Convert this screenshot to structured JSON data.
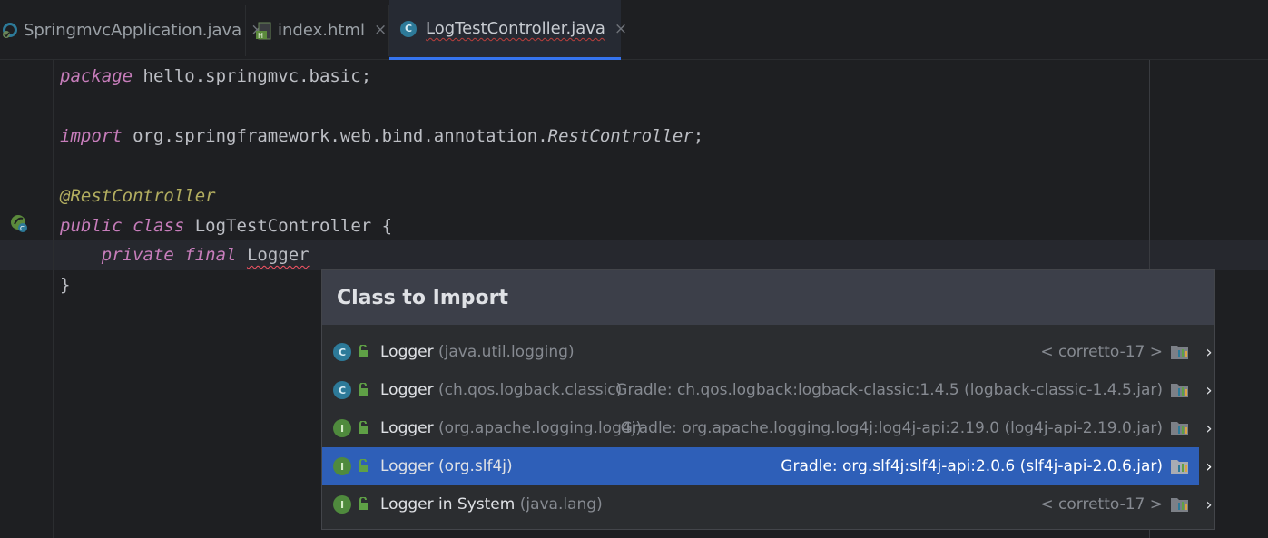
{
  "tabs": [
    {
      "label": "SpringmvcApplication.java",
      "icon": "spring-class-icon",
      "close": "×"
    },
    {
      "label": "index.html",
      "icon": "html-file-icon",
      "close": "×"
    },
    {
      "label": "LogTestController.java",
      "icon": "class-icon",
      "close": "×",
      "active": true
    }
  ],
  "code": {
    "line1": {
      "kw": "package",
      "rest": " hello.springmvc.basic;"
    },
    "line3": {
      "kw": "import",
      "pkg": " org.springframework.web.bind.annotation.",
      "cls": "RestController",
      "end": ";"
    },
    "line5": {
      "ann": "@RestController"
    },
    "line6": {
      "kw1": "public",
      "kw2": "class",
      "name": " LogTestController {"
    },
    "line7": {
      "kw1": "private",
      "kw2": "final",
      "type": "Logger"
    },
    "line8": {
      "text": "}"
    }
  },
  "popup": {
    "title": "Class to Import",
    "rows": [
      {
        "icon": "class-icon",
        "name": "Logger",
        "pkg": "(java.util.logging)",
        "location": "< corretto-17 >",
        "selected": false
      },
      {
        "icon": "class-icon",
        "name": "Logger",
        "pkg": "(ch.qos.logback.classic)",
        "location": "Gradle: ch.qos.logback:logback-classic:1.4.5 (logback-classic-1.4.5.jar)",
        "selected": false
      },
      {
        "icon": "interface-icon",
        "name": "Logger",
        "pkg": "(org.apache.logging.log4j)",
        "location": "Gradle: org.apache.logging.log4j:log4j-api:2.19.0 (log4j-api-2.19.0.jar)",
        "selected": false
      },
      {
        "icon": "interface-icon",
        "name": "Logger (org.slf4j)",
        "pkg": "",
        "location": "Gradle: org.slf4j:slf4j-api:2.0.6 (slf4j-api-2.0.6.jar)",
        "selected": true
      },
      {
        "icon": "interface-icon",
        "name": "Logger in System",
        "pkg": "(java.lang)",
        "location": "< corretto-17 >",
        "selected": false
      }
    ]
  },
  "colors": {
    "accent": "#3574f0",
    "selection": "#2e5fb8",
    "popup_header": "#3c3f49"
  }
}
